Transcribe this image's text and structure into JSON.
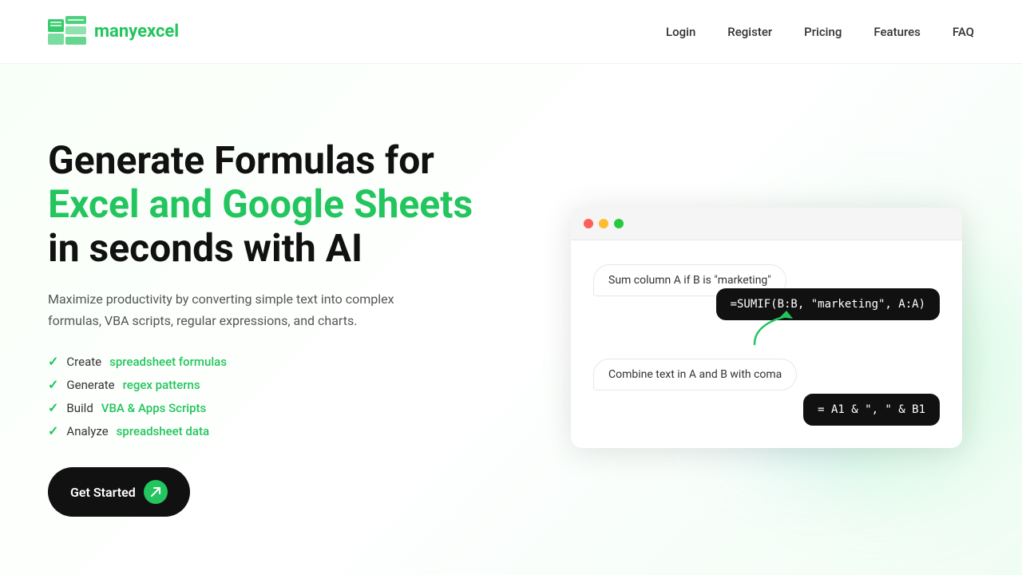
{
  "brand": {
    "name_part1": "many",
    "name_part2": "excel"
  },
  "nav": {
    "links": [
      {
        "label": "Login",
        "href": "#"
      },
      {
        "label": "Register",
        "href": "#"
      },
      {
        "label": "Pricing",
        "href": "#"
      },
      {
        "label": "Features",
        "href": "#"
      },
      {
        "label": "FAQ",
        "href": "#"
      }
    ]
  },
  "hero": {
    "heading_line1": "Generate Formulas for",
    "heading_accent": "Excel and Google Sheets",
    "heading_line3": "in seconds with AI",
    "description": "Maximize productivity by converting simple text into complex formulas, VBA scripts, regular expressions, and charts.",
    "features": [
      {
        "text": "Create ",
        "link_text": "spreadsheet formulas",
        "href": "#"
      },
      {
        "text": "Generate ",
        "link_text": "regex patterns",
        "href": "#"
      },
      {
        "text": "Build ",
        "link_text": "VBA & Apps Scripts",
        "href": "#"
      },
      {
        "text": "Analyze ",
        "link_text": "spreadsheet data",
        "href": "#"
      }
    ],
    "cta_label": "Get Started"
  },
  "demo": {
    "prompt1": "Sum column A if B is \"marketing\"",
    "formula1": "=SUMIF(B:B, \"marketing\", A:A)",
    "prompt2": "Combine text in A and B with coma",
    "formula2": "= A1 & \", \" & B1"
  },
  "colors": {
    "accent": "#22c55e",
    "dark": "#111111"
  }
}
